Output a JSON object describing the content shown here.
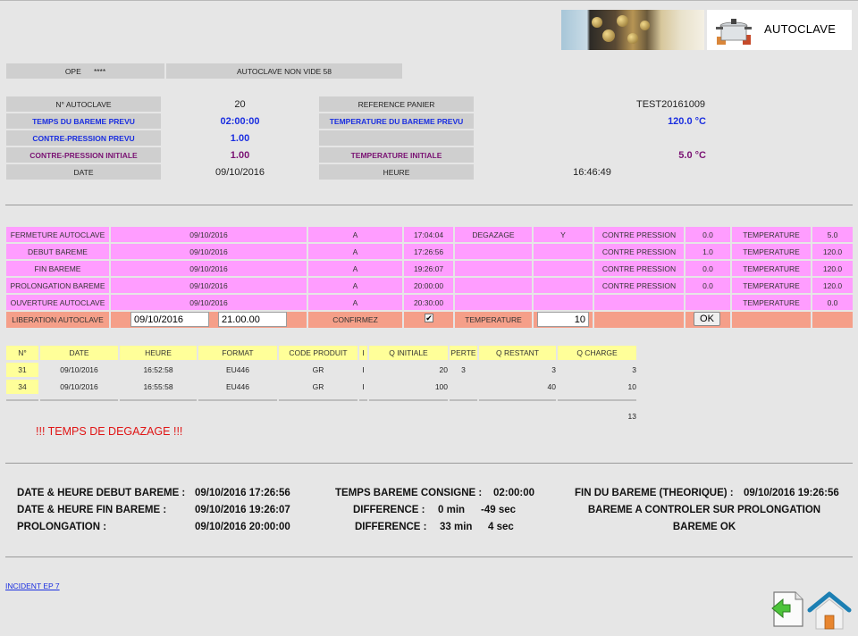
{
  "header": {
    "app_title": "AUTOCLAVE",
    "ope_label": "OPE",
    "ope_value": "****",
    "autoclave_status": "AUTOCLAVE NON VIDE 58"
  },
  "info": {
    "autoclave_no_label": "N° AUTOCLAVE",
    "autoclave_no": "20",
    "reference_panier_label": "REFERENCE PANIER",
    "reference_panier": "TEST20161009",
    "temps_bareme_label": "TEMPS DU BAREME PREVU",
    "temps_bareme": "02:00:00",
    "temp_bareme_label": "TEMPERATURE DU BAREME PREVU",
    "temp_bareme": "120.0 °C",
    "contre_pression_prevu_label": "CONTRE-PRESSION PREVU",
    "contre_pression_prevu": "1.00",
    "contre_pression_init_label": "CONTRE-PRESSION INITIALE",
    "contre_pression_init": "1.00",
    "temp_initiale_label": "TEMPERATURE INITIALE",
    "temp_initiale": "5.0 °C",
    "date_label": "DATE",
    "date": "09/10/2016",
    "heure_label": "HEURE",
    "heure": "16:46:49"
  },
  "events": {
    "a_label": "A",
    "contre_pression_label": "CONTRE PRESSION",
    "temperature_label": "TEMPERATURE",
    "degazage_label": "DEGAZAGE",
    "degazage_value": "Y",
    "rows": [
      {
        "label": "FERMETURE AUTOCLAVE",
        "date": "09/10/2016",
        "time": "17:04:04",
        "cp": "0.0",
        "temp": "5.0"
      },
      {
        "label": "DEBUT BAREME",
        "date": "09/10/2016",
        "time": "17:26:56",
        "cp": "1.0",
        "temp": "120.0"
      },
      {
        "label": "FIN BAREME",
        "date": "09/10/2016",
        "time": "19:26:07",
        "cp": "0.0",
        "temp": "120.0"
      },
      {
        "label": "PROLONGATION BAREME",
        "date": "09/10/2016",
        "time": "20:00:00",
        "cp": "0.0",
        "temp": "120.0"
      },
      {
        "label": "OUVERTURE AUTOCLAVE",
        "date": "09/10/2016",
        "time": "20:30:00",
        "cp": "",
        "temp": "0.0"
      }
    ],
    "liberation": {
      "label": "LIBERATION AUTOCLAVE",
      "date_value": "09/10/2016",
      "time_value": "21.00.00",
      "confirmez_label": "CONFIRMEZ",
      "checkbox_mark": "✔",
      "temperature_label": "TEMPERATURE",
      "temperature_value": "10",
      "ok_label": "OK"
    }
  },
  "products": {
    "headers": [
      "N°",
      "DATE",
      "HEURE",
      "FORMAT",
      "CODE PRODUIT",
      "I",
      "Q INITIALE",
      "PERTE",
      "Q RESTANT",
      "Q CHARGE"
    ],
    "rows": [
      {
        "no": "31",
        "date": "09/10/2016",
        "heure": "16:52:58",
        "format": "EU446",
        "code": "GR",
        "i": "I",
        "q_init": "20",
        "perte": "3",
        "q_rest": "3",
        "q_charge": "3"
      },
      {
        "no": "34",
        "date": "09/10/2016",
        "heure": "16:55:58",
        "format": "EU446",
        "code": "GR",
        "i": "I",
        "q_init": "100",
        "perte": "",
        "q_rest": "40",
        "q_charge": "10"
      }
    ],
    "total": "13"
  },
  "warning": "!!! TEMPS DE DEGAZAGE !!!",
  "summary": {
    "debut_label": "DATE & HEURE DEBUT BAREME :",
    "debut_value": "09/10/2016 17:26:56",
    "fin_label": "DATE & HEURE FIN BAREME :",
    "fin_value": "09/10/2016 19:26:07",
    "prolongation_label": "PROLONGATION :",
    "prolongation_value": "09/10/2016 20:00:00",
    "consigne_label": "TEMPS BAREME CONSIGNE :",
    "consigne_value": "02:00:00",
    "diff1_label": "DIFFERENCE :",
    "diff1_min": "0 min",
    "diff1_sec": "-49 sec",
    "diff2_label": "DIFFERENCE :",
    "diff2_min": "33 min",
    "diff2_sec": "4 sec",
    "fin_theorique_label": "FIN DU BAREME (THEORIQUE) :",
    "fin_theorique_value": "09/10/2016 19:26:56",
    "msg_controle": "BAREME A CONTROLER SUR PROLONGATION",
    "msg_ok": "BAREME OK"
  },
  "footer": {
    "incident_link": "INCIDENT EP 7"
  },
  "icons": {
    "back": "back-document-icon",
    "home": "home-icon"
  },
  "colors": {
    "pink": "#ff9dff",
    "salmon": "#f59f89",
    "yellow": "#ffff99",
    "blue": "#1a2ee0",
    "purple": "#7a1273",
    "green": "#1e8a1e",
    "red": "#e01515"
  }
}
